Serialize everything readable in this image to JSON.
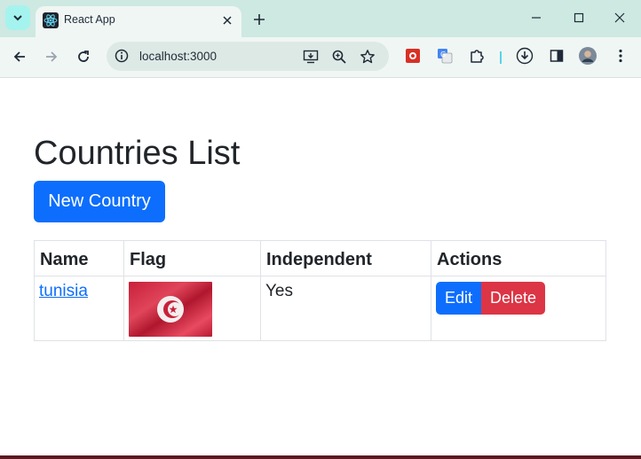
{
  "browser": {
    "tab": {
      "title": "React App"
    },
    "address": {
      "url": "localhost:3000"
    },
    "colors": {
      "tabstrip": "#cde9e1",
      "toolbar": "#f0f6f4"
    }
  },
  "page": {
    "title": "Countries List",
    "new_button_label": "New Country",
    "table": {
      "headers": {
        "name": "Name",
        "flag": "Flag",
        "independent": "Independent",
        "actions": "Actions"
      },
      "rows": [
        {
          "name": "tunisia",
          "flag_icon": "tunisia-flag",
          "independent": "Yes",
          "edit_label": "Edit",
          "delete_label": "Delete"
        }
      ]
    },
    "colors": {
      "primary": "#0d6efd",
      "danger": "#dc3545",
      "text": "#212529"
    }
  }
}
